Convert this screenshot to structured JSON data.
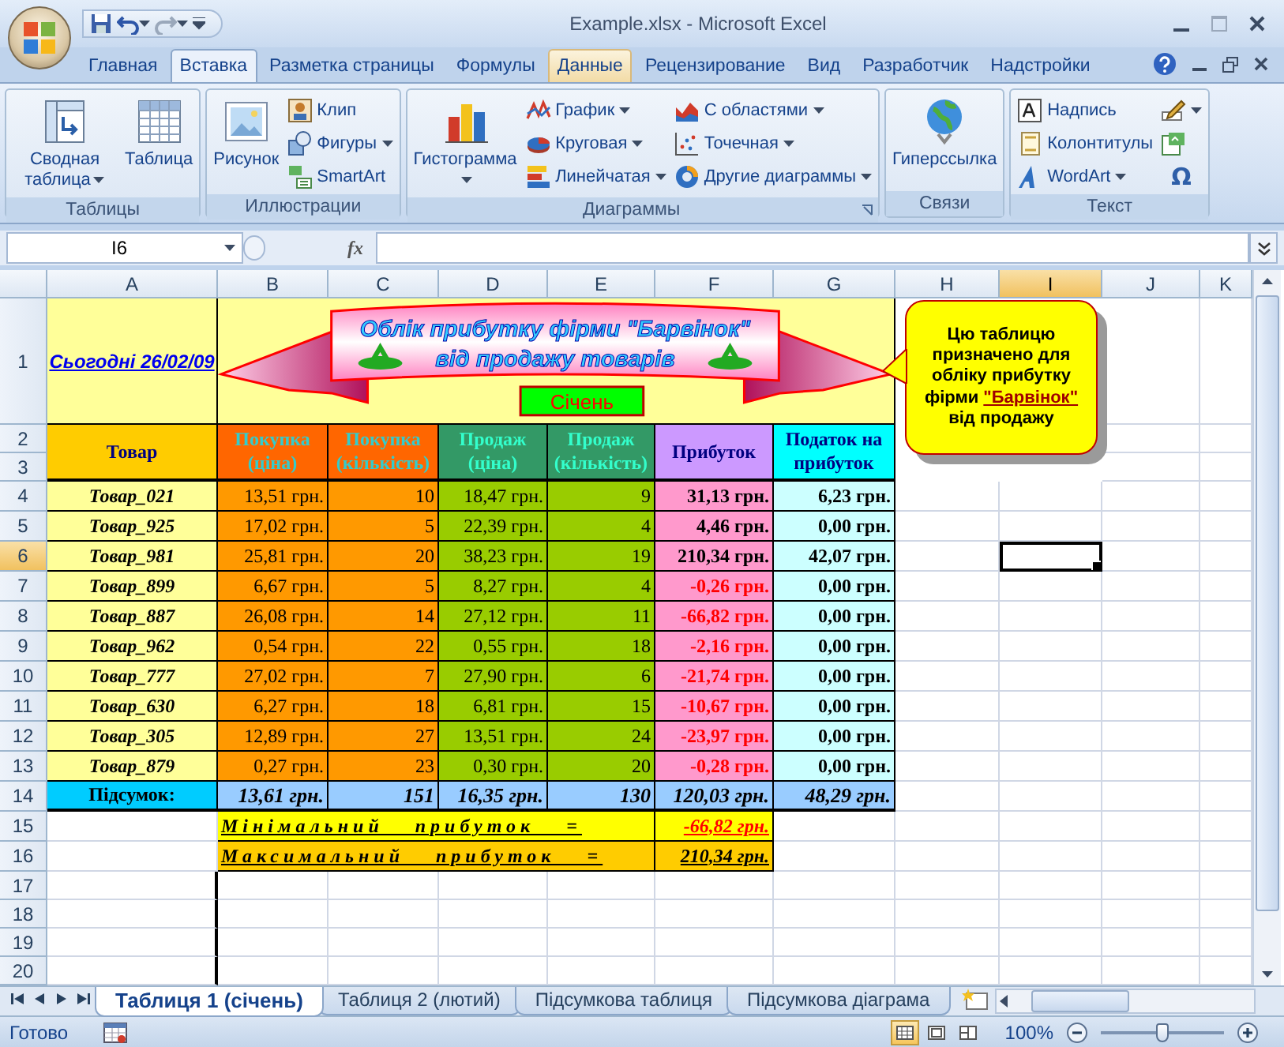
{
  "window": {
    "title": "Example.xlsx - Microsoft Excel"
  },
  "ribbon_tabs": [
    {
      "label": "Главная",
      "selected": false,
      "hovered": false
    },
    {
      "label": "Вставка",
      "selected": true,
      "hovered": false
    },
    {
      "label": "Разметка страницы",
      "selected": false,
      "hovered": false
    },
    {
      "label": "Формулы",
      "selected": false,
      "hovered": false
    },
    {
      "label": "Данные",
      "selected": false,
      "hovered": true
    },
    {
      "label": "Рецензирование",
      "selected": false,
      "hovered": false
    },
    {
      "label": "Вид",
      "selected": false,
      "hovered": false
    },
    {
      "label": "Разработчик",
      "selected": false,
      "hovered": false
    },
    {
      "label": "Надстройки",
      "selected": false,
      "hovered": false
    }
  ],
  "ribbon_groups": [
    {
      "label": "Таблицы",
      "dialog_launcher": false,
      "items": [
        {
          "kind": "large",
          "label": "Сводная таблица",
          "dropdown": true
        },
        {
          "kind": "large",
          "label": "Таблица",
          "dropdown": false
        }
      ]
    },
    {
      "label": "Иллюстрации",
      "dialog_launcher": false,
      "items": [
        {
          "kind": "large",
          "label": "Рисунок",
          "dropdown": false
        },
        {
          "kind": "small",
          "label": "Клип",
          "dropdown": false
        },
        {
          "kind": "small",
          "label": "Фигуры",
          "dropdown": true
        },
        {
          "kind": "small",
          "label": "SmartArt",
          "dropdown": false
        }
      ]
    },
    {
      "label": "Диаграммы",
      "dialog_launcher": true,
      "items": [
        {
          "kind": "large",
          "label": "Гистограмма",
          "dropdown": true
        },
        {
          "kind": "small",
          "label": "График",
          "dropdown": true
        },
        {
          "kind": "small",
          "label": "Круговая",
          "dropdown": true
        },
        {
          "kind": "small",
          "label": "Линейчатая",
          "dropdown": true
        },
        {
          "kind": "small",
          "label": "С областями",
          "dropdown": true
        },
        {
          "kind": "small",
          "label": "Точечная",
          "dropdown": true
        },
        {
          "kind": "small",
          "label": "Другие диаграммы",
          "dropdown": true
        }
      ]
    },
    {
      "label": "Связи",
      "dialog_launcher": false,
      "items": [
        {
          "kind": "large",
          "label": "Гиперссылка",
          "dropdown": false
        }
      ]
    },
    {
      "label": "Текст",
      "dialog_launcher": false,
      "items": [
        {
          "kind": "small",
          "label": "Надпись",
          "dropdown": false
        },
        {
          "kind": "small",
          "label": "Колонтитулы",
          "dropdown": false
        },
        {
          "kind": "small",
          "label": "WordArt",
          "dropdown": true
        },
        {
          "kind": "icon",
          "dropdown": true
        },
        {
          "kind": "icon",
          "dropdown": false
        },
        {
          "kind": "glyph",
          "label": "Ω",
          "dropdown": false
        }
      ]
    }
  ],
  "name_box": "I6",
  "function_label": "fx",
  "columns": [
    {
      "label": "A",
      "selected": false
    },
    {
      "label": "B",
      "selected": false
    },
    {
      "label": "C",
      "selected": false
    },
    {
      "label": "D",
      "selected": false
    },
    {
      "label": "E",
      "selected": false
    },
    {
      "label": "F",
      "selected": false
    },
    {
      "label": "G",
      "selected": false
    },
    {
      "label": "H",
      "selected": false
    },
    {
      "label": "I",
      "selected": true
    },
    {
      "label": "J",
      "selected": false
    },
    {
      "label": "K",
      "selected": false
    }
  ],
  "rows": [
    {
      "label": "1",
      "selected": false
    },
    {
      "label": "2",
      "selected": false
    },
    {
      "label": "3",
      "selected": false
    },
    {
      "label": "4",
      "selected": false
    },
    {
      "label": "5",
      "selected": false
    },
    {
      "label": "6",
      "selected": true
    },
    {
      "label": "7",
      "selected": false
    },
    {
      "label": "8",
      "selected": false
    },
    {
      "label": "9",
      "selected": false
    },
    {
      "label": "10",
      "selected": false
    },
    {
      "label": "11",
      "selected": false
    },
    {
      "label": "12",
      "selected": false
    },
    {
      "label": "13",
      "selected": false
    },
    {
      "label": "14",
      "selected": false
    },
    {
      "label": "15",
      "selected": false
    },
    {
      "label": "16",
      "selected": false
    },
    {
      "label": "17",
      "selected": false
    },
    {
      "label": "18",
      "selected": false
    },
    {
      "label": "19",
      "selected": false
    },
    {
      "label": "20",
      "selected": false
    }
  ],
  "date_cell": "Сьогодні 26/02/09",
  "banner": {
    "line1": "Облік прибутку фірми \"Барвінок\"",
    "line2": "від продажу товарів",
    "month": "Січень"
  },
  "callout": {
    "text_before": "Цю таблицю призначено для обліку прибутку фірми ",
    "link": "\"Барвінок\"",
    "text_after": " від продажу"
  },
  "table": {
    "columns": [
      {
        "label": "Товар",
        "color": "#ffcc00"
      },
      {
        "label": "Покупка (ціна)",
        "color": "#ff6600"
      },
      {
        "label": "Покупка (кількість)",
        "color": "#ff6600"
      },
      {
        "label": "Продаж (ціна)",
        "color": "#339966"
      },
      {
        "label": "Продаж (кількість)",
        "color": "#339966"
      },
      {
        "label": "Прибуток",
        "color": "#cc99ff"
      },
      {
        "label": "Податок на прибуток",
        "color": "#00ffff"
      }
    ],
    "rows": [
      {
        "cells": [
          "Товар_021",
          "13,51 грн.",
          "10",
          "18,47 грн.",
          "9",
          "31,13 грн.",
          "6,23 грн."
        ],
        "negative": false
      },
      {
        "cells": [
          "Товар_925",
          "17,02 грн.",
          "5",
          "22,39 грн.",
          "4",
          "4,46 грн.",
          "0,00 грн."
        ],
        "negative": false
      },
      {
        "cells": [
          "Товар_981",
          "25,81 грн.",
          "20",
          "38,23 грн.",
          "19",
          "210,34 грн.",
          "42,07 грн."
        ],
        "negative": false
      },
      {
        "cells": [
          "Товар_899",
          "6,67 грн.",
          "5",
          "8,27 грн.",
          "4",
          "-0,26 грн.",
          "0,00 грн."
        ],
        "negative": true
      },
      {
        "cells": [
          "Товар_887",
          "26,08 грн.",
          "14",
          "27,12 грн.",
          "11",
          "-66,82 грн.",
          "0,00 грн."
        ],
        "negative": true
      },
      {
        "cells": [
          "Товар_962",
          "0,54 грн.",
          "22",
          "0,55 грн.",
          "18",
          "-2,16 грн.",
          "0,00 грн."
        ],
        "negative": true
      },
      {
        "cells": [
          "Товар_777",
          "27,02 грн.",
          "7",
          "27,90 грн.",
          "6",
          "-21,74 грн.",
          "0,00 грн."
        ],
        "negative": true
      },
      {
        "cells": [
          "Товар_630",
          "6,27 грн.",
          "18",
          "6,81 грн.",
          "15",
          "-10,67 грн.",
          "0,00 грн."
        ],
        "negative": true
      },
      {
        "cells": [
          "Товар_305",
          "12,89 грн.",
          "27",
          "13,51 грн.",
          "24",
          "-23,97 грн.",
          "0,00 грн."
        ],
        "negative": true
      },
      {
        "cells": [
          "Товар_879",
          "0,27 грн.",
          "23",
          "0,30 грн.",
          "20",
          "-0,28 грн.",
          "0,00 грн."
        ],
        "negative": true
      }
    ],
    "totals": [
      "Підсумок:",
      "13,61 грн.",
      "151",
      "16,35 грн.",
      "130",
      "120,03 грн.",
      "48,29 грн."
    ]
  },
  "summary": [
    {
      "label": "Мінімальний прибуток =",
      "value": "-66,82 грн.",
      "negative": true
    },
    {
      "label": "Максимальний прибуток =",
      "value": "210,34 грн.",
      "negative": false
    }
  ],
  "sheet_tabs": [
    {
      "label": "Таблиця 1 (січень)",
      "selected": true
    },
    {
      "label": "Таблиця 2 (лютий)",
      "selected": false
    },
    {
      "label": "Підсумкова таблиця",
      "selected": false
    },
    {
      "label": "Підсумкова діаграма",
      "selected": false
    }
  ],
  "status_bar": {
    "text": "Готово",
    "view_buttons": [
      {
        "selected": true
      },
      {
        "selected": false
      },
      {
        "selected": false
      }
    ],
    "zoom": "100%",
    "zoom_slider": {
      "level": 0.5
    }
  }
}
